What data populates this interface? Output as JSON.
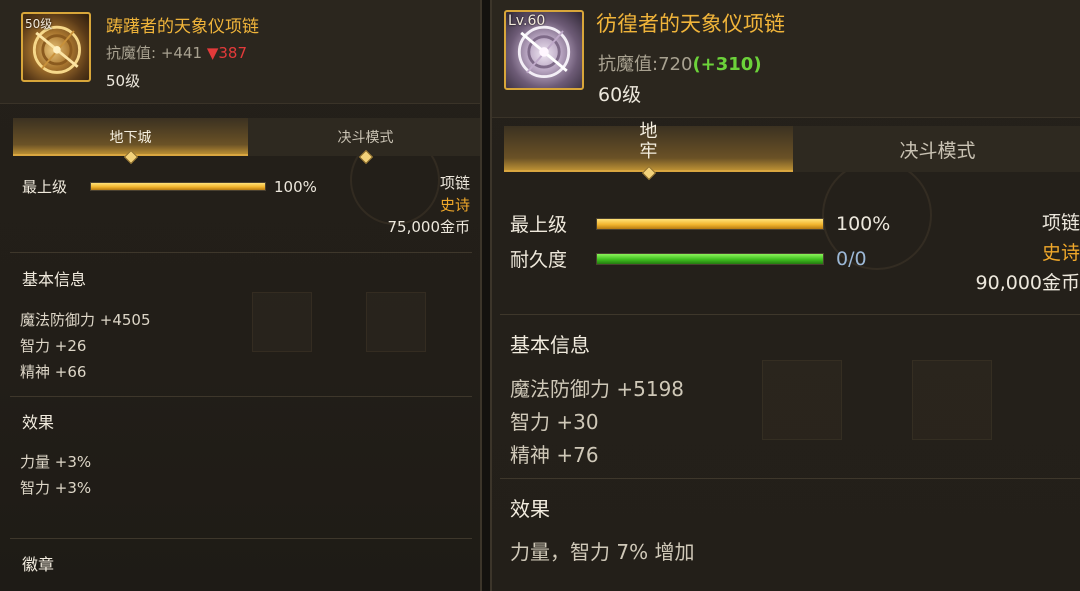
{
  "left": {
    "icon": {
      "name": "celestial-necklace-icon",
      "level_badge": "50级"
    },
    "item_name": "踌躇者的天象仪项链",
    "resist": {
      "label": "抗魔值:",
      "value": "+441",
      "diff_symbol": "▼",
      "diff_value": "387"
    },
    "level_text": "50级",
    "tabs": [
      {
        "label": "地下城",
        "active": true
      },
      {
        "label": "决斗模式",
        "active": false
      }
    ],
    "stats": [
      {
        "label": "最上级",
        "percent": 100,
        "value": "100%",
        "color": "#f2b52e"
      }
    ],
    "type": {
      "name": "项链",
      "rarity": "史诗",
      "price": "75,000金币"
    },
    "basic_info": {
      "title": "基本信息",
      "lines": [
        "魔法防御力 +4505",
        "智力 +26",
        "精神 +66"
      ]
    },
    "effects": {
      "title": "效果",
      "lines": [
        "力量 +3%",
        "智力 +3%"
      ]
    },
    "emblem_title": "徽章",
    "colors": {
      "accent": "#f0b43a",
      "down": "#e23a3a",
      "rarity": "#f0a82a"
    }
  },
  "right": {
    "icon": {
      "name": "celestial-necklace-icon",
      "level_badge": "Lv.60"
    },
    "item_name": "彷徨者的天象仪项链",
    "resist": {
      "label": "抗魔值:",
      "value": "720",
      "bonus": "(+310)"
    },
    "level_text": "60级",
    "tabs": [
      {
        "label": "地\n牢",
        "active": true
      },
      {
        "label": "决斗模式",
        "active": false
      }
    ],
    "stats": [
      {
        "label": "最上级",
        "percent": 100,
        "value": "100%",
        "color": "#f2b52e"
      },
      {
        "label": "耐久度",
        "percent": 100,
        "value": "0/0",
        "color": "#3fbf1f"
      }
    ],
    "type": {
      "name": "项链",
      "rarity": "史诗",
      "price": "90,000金币"
    },
    "basic_info": {
      "title": "基本信息",
      "lines": [
        "魔法防御力 +5198",
        "智力 +30",
        "精神 +76"
      ]
    },
    "effects": {
      "title": "效果",
      "lines": [
        "力量，智力 7% 增加"
      ]
    },
    "colors": {
      "accent": "#f0b43a",
      "up": "#6cd23a",
      "rarity": "#f0a82a"
    }
  }
}
